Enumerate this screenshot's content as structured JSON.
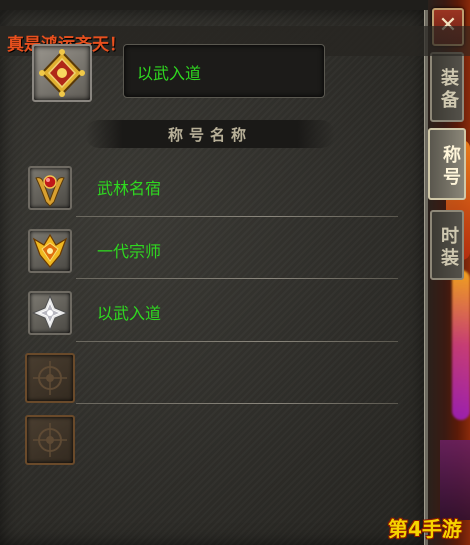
{
  "banner": {
    "text": "真是鸿运齐天！"
  },
  "close_button": {
    "label": "✕"
  },
  "tabs": [
    {
      "label": "装备",
      "active": false
    },
    {
      "label": "称号",
      "active": true
    },
    {
      "label": "时装",
      "active": false
    }
  ],
  "current_title": {
    "icon": "diamond-emblem-icon",
    "text": "以武入道"
  },
  "section_header": "称号名称",
  "titles": [
    {
      "label": "武林名宿",
      "icon": "red-gem-crest-icon"
    },
    {
      "label": "一代宗师",
      "icon": "golden-wing-crest-icon"
    },
    {
      "label": "以武入道",
      "icon": "silver-star-emblem-icon"
    },
    {
      "label": "",
      "icon": "locked-slot-icon"
    },
    {
      "label": "",
      "icon": "locked-slot-icon"
    }
  ],
  "watermark": "第4手游",
  "colors": {
    "banner_text": "#e8501e",
    "title_text": "#2fd820",
    "watermark": "#f6d400"
  }
}
